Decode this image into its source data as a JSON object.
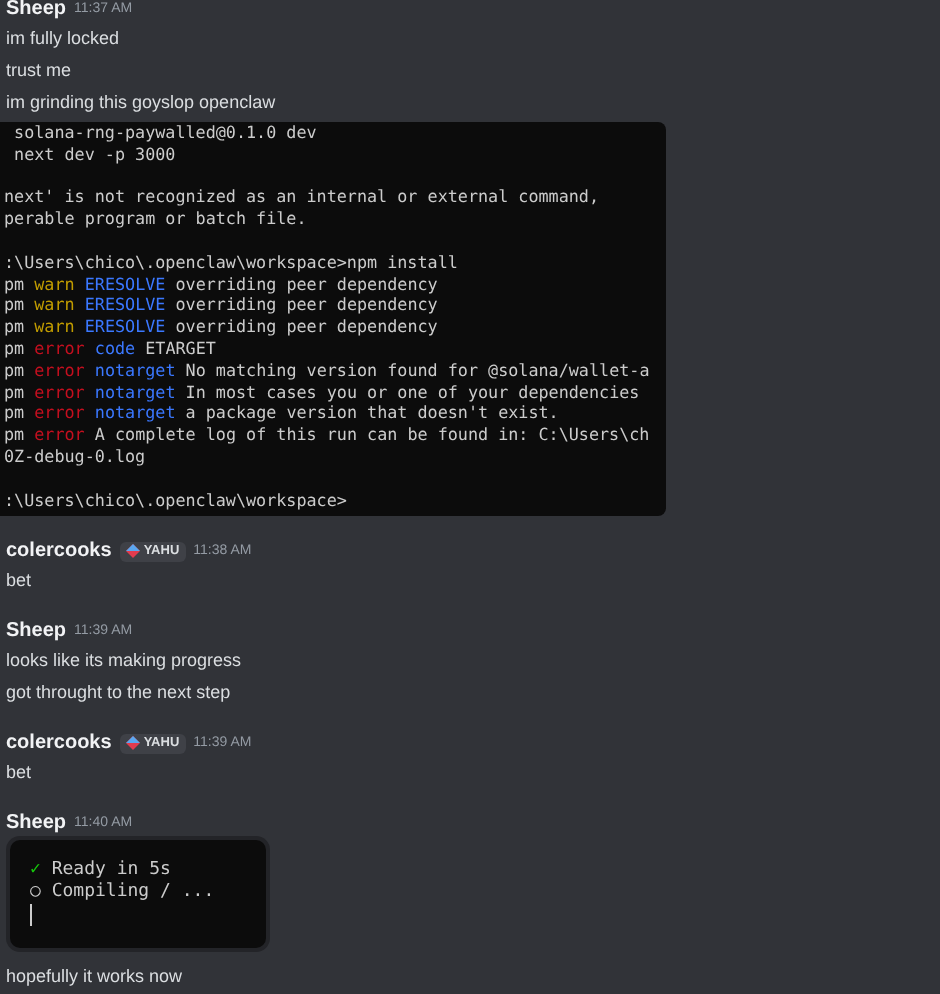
{
  "messages": [
    {
      "author": "Sheep",
      "time": "11:37 AM",
      "content": [
        {
          "kind": "text",
          "text": "im fully locked"
        },
        {
          "kind": "text",
          "text": "trust me"
        },
        {
          "kind": "text",
          "text": "im grinding this goyslop openclaw"
        },
        {
          "kind": "terminal",
          "lines": [
            {
              "segments": [
                {
                  "text": " solana-rng-paywalled@0.1.0 dev"
                }
              ]
            },
            {
              "segments": [
                {
                  "text": " next dev -p 3000"
                }
              ]
            },
            {
              "gap": true,
              "segments": [
                {
                  "text": "next' is not recognized as an internal or external command,"
                }
              ]
            },
            {
              "segments": [
                {
                  "text": "perable program or batch file."
                }
              ]
            },
            {
              "gap": true,
              "segments": [
                {
                  "text": ":\\Users\\chico\\.openclaw\\workspace>npm install"
                }
              ]
            },
            {
              "segments": [
                {
                  "text": "pm "
                },
                {
                  "color": "#c19c00",
                  "text": "warn "
                },
                {
                  "color": "#3b78ff",
                  "text": "ERESOLVE"
                },
                {
                  "text": " overriding peer dependency"
                }
              ]
            },
            {
              "segments": [
                {
                  "text": "pm "
                },
                {
                  "color": "#c19c00",
                  "text": "warn "
                },
                {
                  "color": "#3b78ff",
                  "text": "ERESOLVE"
                },
                {
                  "text": " overriding peer dependency"
                }
              ]
            },
            {
              "segments": [
                {
                  "text": "pm "
                },
                {
                  "color": "#c19c00",
                  "text": "warn "
                },
                {
                  "color": "#3b78ff",
                  "text": "ERESOLVE"
                },
                {
                  "text": " overriding peer dependency"
                }
              ]
            },
            {
              "segments": [
                {
                  "text": "pm "
                },
                {
                  "color": "#c50f1f",
                  "text": "error "
                },
                {
                  "color": "#3b78ff",
                  "text": "code"
                },
                {
                  "text": " ETARGET"
                }
              ]
            },
            {
              "segments": [
                {
                  "text": "pm "
                },
                {
                  "color": "#c50f1f",
                  "text": "error "
                },
                {
                  "color": "#3b78ff",
                  "text": "notarget"
                },
                {
                  "text": " No matching version found for @solana/wallet-a"
                }
              ]
            },
            {
              "segments": [
                {
                  "text": "pm "
                },
                {
                  "color": "#c50f1f",
                  "text": "error "
                },
                {
                  "color": "#3b78ff",
                  "text": "notarget"
                },
                {
                  "text": " In most cases you or one of your dependencies"
                }
              ]
            },
            {
              "segments": [
                {
                  "text": "pm "
                },
                {
                  "color": "#c50f1f",
                  "text": "error "
                },
                {
                  "color": "#3b78ff",
                  "text": "notarget"
                },
                {
                  "text": " a package version that doesn't exist."
                }
              ]
            },
            {
              "segments": [
                {
                  "text": "pm "
                },
                {
                  "color": "#c50f1f",
                  "text": "error"
                },
                {
                  "text": " A complete log of this run can be found in: C:\\Users\\ch"
                }
              ]
            },
            {
              "segments": [
                {
                  "text": "0Z-debug-0.log"
                }
              ]
            },
            {
              "gap": true,
              "segments": [
                {
                  "text": ":\\Users\\chico\\.openclaw\\workspace>"
                }
              ]
            }
          ]
        }
      ]
    },
    {
      "author": "colercooks",
      "badge": "YAHU",
      "time": "11:38 AM",
      "content": [
        {
          "kind": "text",
          "text": "bet"
        }
      ]
    },
    {
      "author": "Sheep",
      "time": "11:39 AM",
      "content": [
        {
          "kind": "text",
          "text": "looks like its making progress"
        },
        {
          "kind": "text",
          "text": "got throught to the next step"
        }
      ]
    },
    {
      "author": "colercooks",
      "badge": "YAHU",
      "time": "11:39 AM",
      "content": [
        {
          "kind": "text",
          "text": "bet"
        }
      ]
    },
    {
      "author": "Sheep",
      "time": "11:40 AM",
      "content": [
        {
          "kind": "terminal",
          "framed": true,
          "cursor": true,
          "lines": [
            {
              "segments": [
                {
                  "color": "#16c60c",
                  "text": "✓ "
                },
                {
                  "text": "Ready in 5s"
                }
              ]
            },
            {
              "segments": [
                {
                  "text": "○ Compiling / ..."
                }
              ]
            }
          ]
        },
        {
          "kind": "text",
          "text": "hopefully it works now"
        }
      ]
    }
  ]
}
